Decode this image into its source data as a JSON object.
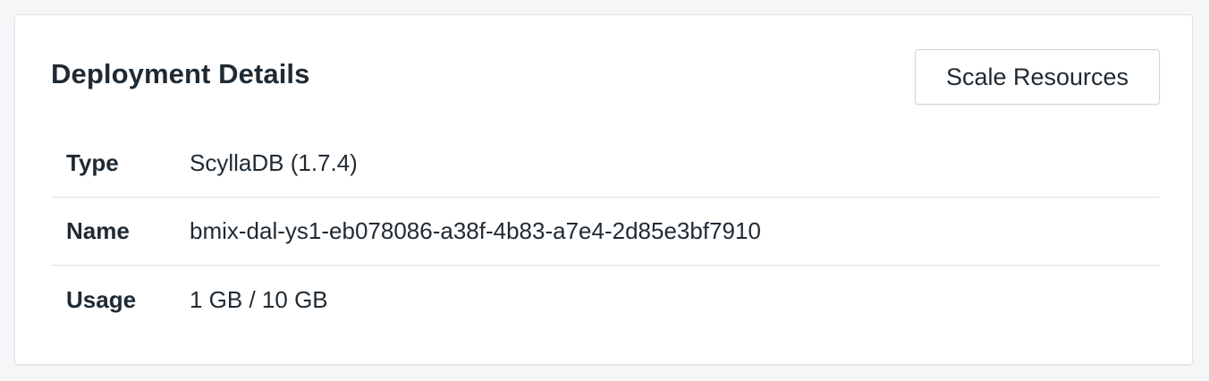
{
  "card": {
    "title": "Deployment Details",
    "scale_button_label": "Scale Resources"
  },
  "details": {
    "rows": [
      {
        "label": "Type",
        "value": "ScyllaDB (1.7.4)"
      },
      {
        "label": "Name",
        "value": "bmix-dal-ys1-eb078086-a38f-4b83-a7e4-2d85e3bf7910"
      },
      {
        "label": "Usage",
        "value": "1 GB / 10 GB"
      }
    ]
  }
}
